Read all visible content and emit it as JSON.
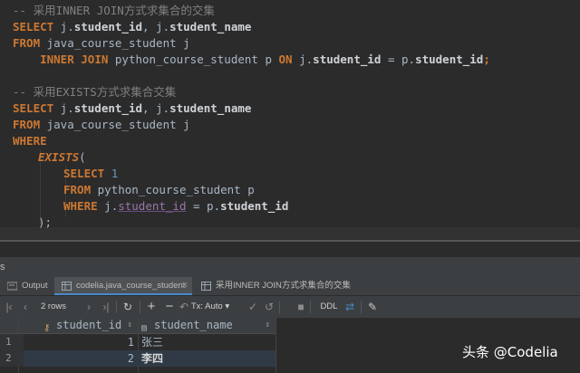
{
  "editor": {
    "comment1": "-- 采用INNER JOIN方式求集合的交集",
    "q1_select": "SELECT",
    "q1_cols_a": " j.",
    "q1_col1": "student_id",
    "q1_cols_b": ", j.",
    "q1_col2": "student_name",
    "q1_from": "FROM",
    "q1_table": " java_course_student j",
    "q1_indent": "    ",
    "q1_inner": "INNER JOIN",
    "q1_join_table": " python_course_student p ",
    "q1_on": "ON",
    "q1_cond_a": " j.",
    "q1_cond_col_a": "student_id",
    "q1_cond_b": " = p.",
    "q1_cond_col_b": "student_id",
    "q1_end": ";",
    "comment2": "-- 采用EXISTS方式求集合交集",
    "q2_select": "SELECT",
    "q2_cols_a": " j.",
    "q2_col1": "student_id",
    "q2_cols_b": ", j.",
    "q2_col2": "student_name",
    "q2_from": "FROM",
    "q2_table": " java_course_student j",
    "q2_where": "WHERE",
    "q2_exists": "EXISTS",
    "q2_paren_open": "(",
    "q2_sub_select": "SELECT",
    "q2_sub_one": "1",
    "q2_sub_from": "FROM",
    "q2_sub_table": " python_course_student p",
    "q2_sub_where": "WHERE",
    "q2_sub_cond_a": " j.",
    "q2_sub_unres": "student_id",
    "q2_sub_cond_b": " = p.",
    "q2_sub_col": "student_id",
    "q2_close": ");"
  },
  "panel": {
    "label": "s"
  },
  "tabs": [
    {
      "label": "Output"
    },
    {
      "label": "codelia.java_course_student"
    },
    {
      "label": "采用INNER JOIN方式求集合的交集"
    }
  ],
  "toolbar": {
    "rows_label": "2 rows",
    "tx_label": "Tx: Auto",
    "ddl_label": "DDL"
  },
  "grid": {
    "columns": [
      "student_id",
      "student_name"
    ],
    "rows": [
      {
        "num": "1",
        "student_id": "1",
        "student_name": "张三"
      },
      {
        "num": "2",
        "student_id": "2",
        "student_name": "李四"
      }
    ]
  },
  "watermark": "头条 @Codelia",
  "colors": {
    "keyword": "#cc7832",
    "comment": "#808080",
    "number": "#6897bb",
    "accent": "#4a88c7"
  }
}
